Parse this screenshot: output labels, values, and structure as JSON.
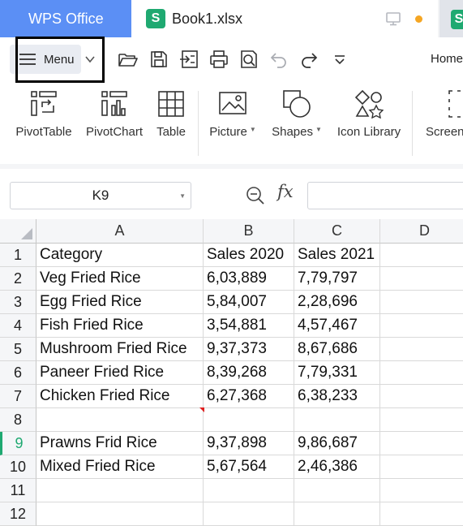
{
  "app": {
    "name": "WPS Office",
    "document_tab": "Book1.xlsx",
    "sheet_glyph": "S"
  },
  "menu": {
    "label": "Menu"
  },
  "ribbon_tab": "Home",
  "ribbon": [
    {
      "label": "PivotTable",
      "icon": "pivot-table-icon"
    },
    {
      "label": "PivotChart",
      "icon": "pivot-chart-icon"
    },
    {
      "label": "Table",
      "icon": "table-icon"
    },
    {
      "label": "Picture",
      "icon": "picture-icon",
      "dropdown": true
    },
    {
      "label": "Shapes",
      "icon": "shapes-icon",
      "dropdown": true
    },
    {
      "label": "Icon Library",
      "icon": "icon-library-icon"
    },
    {
      "label": "Screen",
      "icon": "screenshot-icon"
    }
  ],
  "formula_bar": {
    "name_box": "K9",
    "fx": "fx",
    "formula": ""
  },
  "columns": [
    "A",
    "B",
    "C",
    "D"
  ],
  "rows": [
    {
      "num": "1",
      "cells": [
        "Category",
        "Sales 2020",
        "Sales 2021",
        ""
      ]
    },
    {
      "num": "2",
      "cells": [
        "Veg Fried Rice",
        "6,03,889",
        "7,79,797",
        ""
      ]
    },
    {
      "num": "3",
      "cells": [
        "Egg Fried Rice",
        "5,84,007",
        "2,28,696",
        ""
      ]
    },
    {
      "num": "4",
      "cells": [
        "Fish Fried Rice",
        "3,54,881",
        "4,57,467",
        ""
      ]
    },
    {
      "num": "5",
      "cells": [
        "Mushroom Fried Rice",
        "9,37,373",
        "8,67,686",
        ""
      ]
    },
    {
      "num": "6",
      "cells": [
        "Paneer Fried Rice",
        "8,39,268",
        "7,79,331",
        ""
      ]
    },
    {
      "num": "7",
      "cells": [
        "Chicken Fried Rice",
        "6,27,368",
        "6,38,233",
        ""
      ]
    },
    {
      "num": "8",
      "cells": [
        "",
        "",
        "",
        ""
      ]
    },
    {
      "num": "9",
      "cells": [
        "Prawns Frid Rice",
        "9,37,898",
        "9,86,687",
        ""
      ]
    },
    {
      "num": "10",
      "cells": [
        "Mixed Fried Rice",
        "5,67,564",
        "2,46,386",
        ""
      ]
    },
    {
      "num": "11",
      "cells": [
        "",
        "",
        "",
        ""
      ]
    },
    {
      "num": "12",
      "cells": [
        "",
        "",
        "",
        ""
      ]
    }
  ],
  "active_row": "9",
  "colors": {
    "wps_blue": "#5b8ff5",
    "sheet_green": "#1fa971",
    "status_dot": "#f5a623",
    "comment_red": "#e02020"
  }
}
